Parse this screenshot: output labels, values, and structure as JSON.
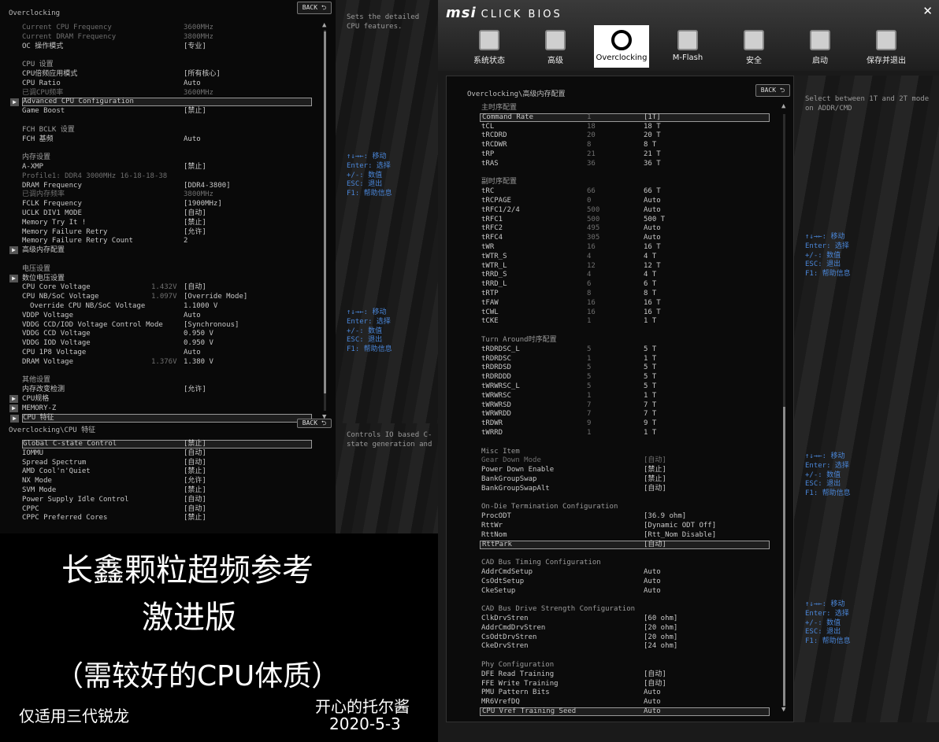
{
  "left": {
    "breadcrumb": "Overclocking",
    "back": "BACK ⮌",
    "help": "Sets the detailed CPU features.",
    "keys": [
      "↑↓→←: 移动",
      "Enter: 选择",
      "+/-: 数值",
      "ESC: 退出",
      "F1: 帮助信息"
    ],
    "rows": [
      {
        "l": "Current CPU Frequency",
        "v": "3600MHz",
        "t": "dim"
      },
      {
        "l": "Current DRAM Frequency",
        "v": "3800MHz",
        "t": "dim"
      },
      {
        "l": "OC 操作模式",
        "v": "[专业]"
      },
      {
        "l": "",
        "v": ""
      },
      {
        "l": "CPU 设置",
        "v": "",
        "t": "head"
      },
      {
        "l": "CPU倍频应用模式",
        "v": "[所有核心]"
      },
      {
        "l": "CPU Ratio",
        "v": "Auto"
      },
      {
        "l": "已调CPU频率",
        "v": "3600MHz",
        "t": "dim"
      },
      {
        "l": "Advanced CPU Configuration",
        "v": "",
        "t": "sel sub"
      },
      {
        "l": "Game Boost",
        "v": "[禁止]"
      },
      {
        "l": "",
        "v": ""
      },
      {
        "l": "FCH BCLK 设置",
        "v": "",
        "t": "head"
      },
      {
        "l": "FCH 基频",
        "v": "Auto"
      },
      {
        "l": "",
        "v": ""
      },
      {
        "l": "内存设置",
        "v": "",
        "t": "head"
      },
      {
        "l": "A-XMP",
        "v": "[禁止]"
      },
      {
        "l": "Profile1: DDR4 3000MHz 16-18-18-38",
        "v": "",
        "t": "dim"
      },
      {
        "l": "DRAM Frequency",
        "v": "[DDR4-3800]"
      },
      {
        "l": "已调内存频率",
        "v": "3800MHz",
        "t": "dim"
      },
      {
        "l": "FCLK Frequency",
        "v": "[1900MHz]"
      },
      {
        "l": "UCLK DIV1 MODE",
        "v": "[自动]"
      },
      {
        "l": "Memory Try It !",
        "v": "[禁止]"
      },
      {
        "l": "Memory Failure Retry",
        "v": "[允许]"
      },
      {
        "l": "Memory Failure Retry Count",
        "v": "2"
      },
      {
        "l": "高级内存配置",
        "v": "",
        "t": "sub"
      },
      {
        "l": "",
        "v": ""
      },
      {
        "l": "电压设置",
        "v": "",
        "t": "head"
      },
      {
        "l": "数位电压设置",
        "v": "",
        "t": "sub"
      },
      {
        "l": "CPU Core Voltage",
        "c": "1.432V",
        "v": "[自动]"
      },
      {
        "l": "CPU NB/SoC Voltage",
        "c": "1.097V",
        "v": "[Override Mode]"
      },
      {
        "l": "Override CPU NB/SoC Voltage",
        "v": "1.1000 V",
        "t": "indent"
      },
      {
        "l": "VDDP Voltage",
        "v": "Auto"
      },
      {
        "l": "VDDG CCD/IOD Voltage Control Mode",
        "v": "[Synchronous]"
      },
      {
        "l": "VDDG CCD Voltage",
        "v": "0.950 V"
      },
      {
        "l": "VDDG IOD Voltage",
        "v": "0.950 V"
      },
      {
        "l": "CPU 1P8 Voltage",
        "v": "Auto"
      },
      {
        "l": "DRAM Voltage",
        "c": "1.376V",
        "v": "1.380 V"
      },
      {
        "l": "",
        "v": ""
      },
      {
        "l": "其他设置",
        "v": "",
        "t": "head"
      },
      {
        "l": "内存改变检测",
        "v": "[允许]"
      },
      {
        "l": "CPU规格",
        "v": "",
        "t": "sub"
      },
      {
        "l": "MEMORY-Z",
        "v": "",
        "t": "sub"
      },
      {
        "l": "CPU 特征",
        "v": "",
        "t": "sel sub"
      }
    ]
  },
  "left_bottom": {
    "breadcrumb": "Overclocking\\CPU 特征",
    "back": "BACK ⮌",
    "help": "Controls IO based C-state generation and DF C-sta",
    "rows": [
      {
        "l": "Global C-state Control",
        "v": "[禁止]",
        "t": "sel"
      },
      {
        "l": "IOMMU",
        "v": "[自动]"
      },
      {
        "l": "Spread Spectrum",
        "v": "[自动]"
      },
      {
        "l": "AMD Cool'n'Quiet",
        "v": "[禁止]"
      },
      {
        "l": "NX Mode",
        "v": "[允许]"
      },
      {
        "l": "SVM Mode",
        "v": "[禁止]"
      },
      {
        "l": "Power Supply Idle Control",
        "v": "[自动]"
      },
      {
        "l": "CPPC",
        "v": "[自动]"
      },
      {
        "l": "CPPC Preferred Cores",
        "v": "[禁止]"
      }
    ]
  },
  "caption": {
    "line1": "长鑫颗粒超频参考",
    "line2": "激进版",
    "line3": "（需较好的CPU体质）",
    "note": "仅适用三代锐龙",
    "author": "开心的托尔酱",
    "date": "2020-5-3"
  },
  "right": {
    "logo": "msi",
    "logo_sub": "CLICK BIOS",
    "close": "✕",
    "nav": [
      "系统状态",
      "高级",
      "Overclocking",
      "M-Flash",
      "安全",
      "启动",
      "保存并退出"
    ],
    "breadcrumb": "Overclocking\\高级内存配置",
    "back": "BACK ⮌",
    "help": "Select between 1T and 2T mode on ADDR/CMD",
    "keys": [
      "↑↓→←: 移动",
      "Enter: 选择",
      "+/-: 数值",
      "ESC: 退出",
      "F1: 帮助信息"
    ],
    "rows": [
      {
        "l": "主时序配置",
        "v": "",
        "t": "head"
      },
      {
        "l": "Command Rate",
        "c": "1",
        "v": "[1T]",
        "t": "sel"
      },
      {
        "l": "tCL",
        "c": "18",
        "v": "18 T"
      },
      {
        "l": "tRCDRD",
        "c": "20",
        "v": "20 T"
      },
      {
        "l": "tRCDWR",
        "c": "8",
        "v": "8 T"
      },
      {
        "l": "tRP",
        "c": "21",
        "v": "21 T"
      },
      {
        "l": "tRAS",
        "c": "36",
        "v": "36 T"
      },
      {
        "l": "",
        "v": ""
      },
      {
        "l": "副时序配置",
        "v": "",
        "t": "head"
      },
      {
        "l": "tRC",
        "c": "66",
        "v": "66 T"
      },
      {
        "l": "tRCPAGE",
        "c": "0",
        "v": "Auto"
      },
      {
        "l": "tRFC1/2/4",
        "c": "500",
        "v": "Auto"
      },
      {
        "l": "tRFC1",
        "c": "500",
        "v": "500 T"
      },
      {
        "l": "tRFC2",
        "c": "495",
        "v": "Auto"
      },
      {
        "l": "tRFC4",
        "c": "305",
        "v": "Auto"
      },
      {
        "l": "tWR",
        "c": "16",
        "v": "16 T"
      },
      {
        "l": "tWTR_S",
        "c": "4",
        "v": "4 T"
      },
      {
        "l": "tWTR_L",
        "c": "12",
        "v": "12 T"
      },
      {
        "l": "tRRD_S",
        "c": "4",
        "v": "4 T"
      },
      {
        "l": "tRRD_L",
        "c": "6",
        "v": "6 T"
      },
      {
        "l": "tRTP",
        "c": "8",
        "v": "8 T"
      },
      {
        "l": "tFAW",
        "c": "16",
        "v": "16 T"
      },
      {
        "l": "tCWL",
        "c": "16",
        "v": "16 T"
      },
      {
        "l": "tCKE",
        "c": "1",
        "v": "1 T"
      },
      {
        "l": "",
        "v": ""
      },
      {
        "l": "Turn Around时序配置",
        "v": "",
        "t": "head"
      },
      {
        "l": "tRDRDSC_L",
        "c": "5",
        "v": "5 T"
      },
      {
        "l": "tRDRDSC",
        "c": "1",
        "v": "1 T"
      },
      {
        "l": "tRDRDSD",
        "c": "5",
        "v": "5 T"
      },
      {
        "l": "tRDRDDD",
        "c": "5",
        "v": "5 T"
      },
      {
        "l": "tWRWRSC_L",
        "c": "5",
        "v": "5 T"
      },
      {
        "l": "tWRWRSC",
        "c": "1",
        "v": "1 T"
      },
      {
        "l": "tWRWRSD",
        "c": "7",
        "v": "7 T"
      },
      {
        "l": "tWRWRDD",
        "c": "7",
        "v": "7 T"
      },
      {
        "l": "tRDWR",
        "c": "9",
        "v": "9 T"
      },
      {
        "l": "tWRRD",
        "c": "1",
        "v": "1 T"
      },
      {
        "l": "",
        "v": ""
      },
      {
        "l": "Misc Item",
        "v": "",
        "t": "head"
      },
      {
        "l": "Gear Down Mode",
        "v": "[自动]",
        "t": "dim"
      },
      {
        "l": "Power Down Enable",
        "v": "[禁止]"
      },
      {
        "l": "BankGroupSwap",
        "v": "[禁止]"
      },
      {
        "l": "BankGroupSwapAlt",
        "v": "[自动]"
      },
      {
        "l": "",
        "v": ""
      },
      {
        "l": "On-Die Termination Configuration",
        "v": "",
        "t": "head"
      },
      {
        "l": "ProcODT",
        "v": "[36.9 ohm]"
      },
      {
        "l": "RttWr",
        "v": "[Dynamic ODT Off]"
      },
      {
        "l": "RttNom",
        "v": "[Rtt_Nom Disable]"
      },
      {
        "l": "RttPark",
        "v": "[自动]",
        "t": "sel"
      },
      {
        "l": "",
        "v": ""
      },
      {
        "l": "CAD Bus Timing Configuration",
        "v": "",
        "t": "head"
      },
      {
        "l": "AddrCmdSetup",
        "v": "Auto"
      },
      {
        "l": "CsOdtSetup",
        "v": "Auto"
      },
      {
        "l": "CkeSetup",
        "v": "Auto"
      },
      {
        "l": "",
        "v": ""
      },
      {
        "l": "CAD Bus Drive Strength Configuration",
        "v": "",
        "t": "head"
      },
      {
        "l": "ClkDrvStren",
        "v": "[60 ohm]"
      },
      {
        "l": "AddrCmdDrvStren",
        "v": "[20 ohm]"
      },
      {
        "l": "CsOdtDrvStren",
        "v": "[20 ohm]"
      },
      {
        "l": "CkeDrvStren",
        "v": "[24 ohm]"
      },
      {
        "l": "",
        "v": ""
      },
      {
        "l": "Phy Configuration",
        "v": "",
        "t": "head"
      },
      {
        "l": "DFE Read Training",
        "v": "[自动]"
      },
      {
        "l": "FFE Write Training",
        "v": "[自动]"
      },
      {
        "l": "PMU Pattern Bits",
        "v": "Auto"
      },
      {
        "l": "MR6VrefDQ",
        "v": "Auto"
      },
      {
        "l": "CPU Vref Training Seed",
        "v": "Auto",
        "t": "sel"
      }
    ]
  }
}
